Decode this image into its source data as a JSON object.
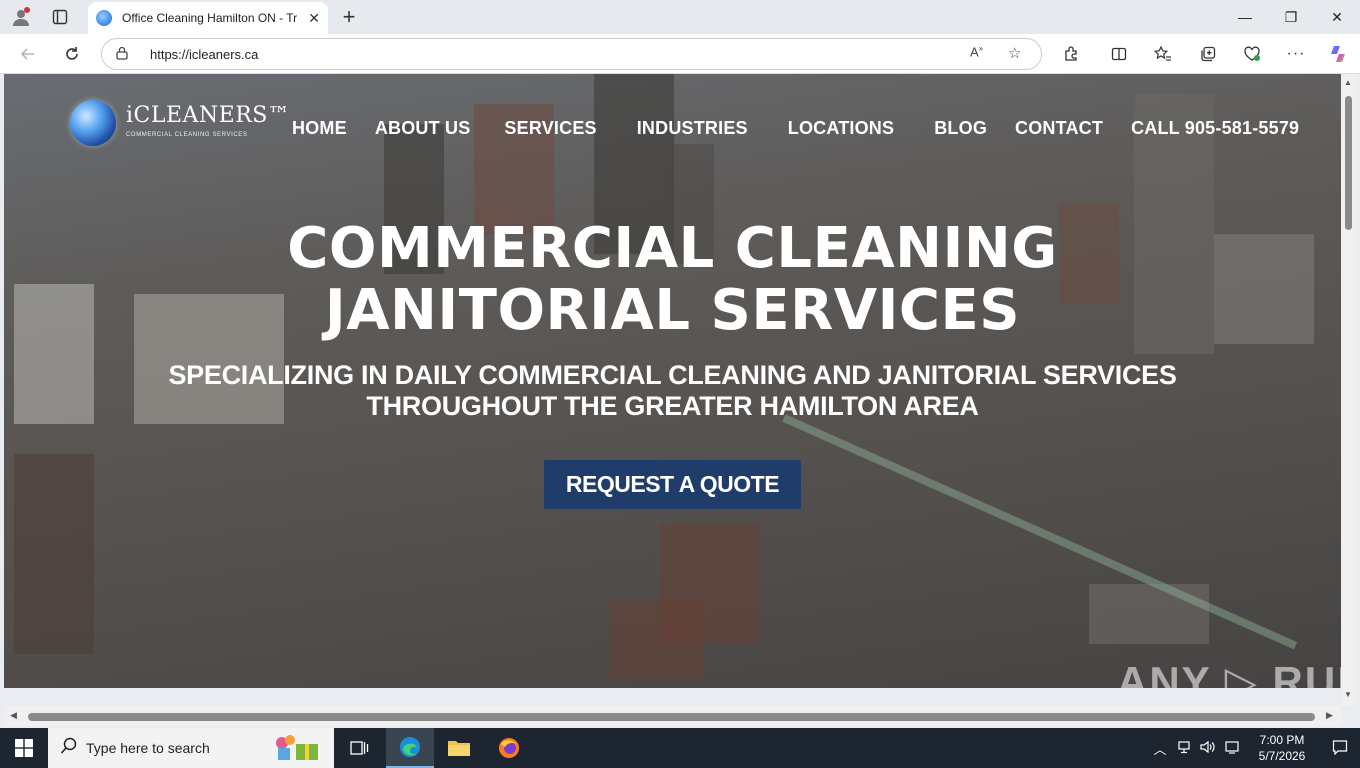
{
  "browser": {
    "tab_title": "Office Cleaning Hamilton ON - Tr",
    "url": "https://icleaners.ca",
    "minimize": "—",
    "restore": "❐",
    "close": "✕",
    "new_tab": "+",
    "tab_close": "✕"
  },
  "site": {
    "logo_brand": "iCLEANERS™",
    "logo_tagline": "COMMERCIAL CLEANING SERVICES",
    "nav": [
      "HOME",
      "ABOUT US",
      "SERVICES",
      "INDUSTRIES",
      "LOCATIONS",
      "BLOG",
      "CONTACT",
      "CALL 905-581-5579"
    ],
    "hero_title_line1": "COMMERCIAL CLEANING",
    "hero_title_line2": "JANITORIAL SERVICES",
    "hero_sub_line1": "SPECIALIZING IN DAILY COMMERCIAL CLEANING AND JANITORIAL SERVICES",
    "hero_sub_line2": "THROUGHOUT THE GREATER HAMILTON AREA",
    "cta": "REQUEST A QUOTE",
    "watermark": "ANY ▷ RUN"
  },
  "taskbar": {
    "search_placeholder": "Type here to search",
    "time": "7:00 PM",
    "date": "5/7/2026"
  },
  "colors": {
    "cta_bg": "#1f3c6a",
    "taskbar_bg": "#1c2530",
    "tab_bg": "#ffffff"
  }
}
